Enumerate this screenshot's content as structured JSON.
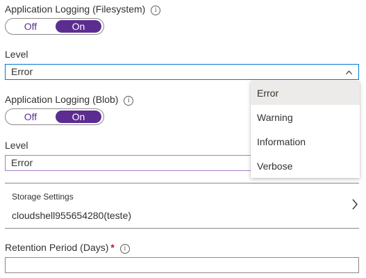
{
  "fs_logging": {
    "label": "Application Logging (Filesystem)",
    "toggle_off": "Off",
    "toggle_on": "On",
    "selected": "On"
  },
  "fs_level": {
    "label": "Level",
    "value": "Error"
  },
  "level_menu": {
    "items": [
      "Error",
      "Warning",
      "Information",
      "Verbose"
    ],
    "selected": "Error"
  },
  "blob_logging": {
    "label": "Application Logging (Blob)",
    "toggle_off": "Off",
    "toggle_on": "On",
    "selected": "On"
  },
  "blob_level": {
    "label": "Level",
    "value": "Error"
  },
  "storage": {
    "label": "Storage Settings",
    "value": "cloudshell955654280(teste)"
  },
  "retention": {
    "label": "Retention Period (Days)",
    "required_marker": "*",
    "value": ""
  },
  "icons": {
    "info": "info-icon",
    "dropdown_open": "chevron-up-icon",
    "navigate": "chevron-right-icon"
  },
  "colors": {
    "accent_purple": "#5c2d91",
    "focus_blue": "#0078d4",
    "required_red": "#a4262c"
  }
}
